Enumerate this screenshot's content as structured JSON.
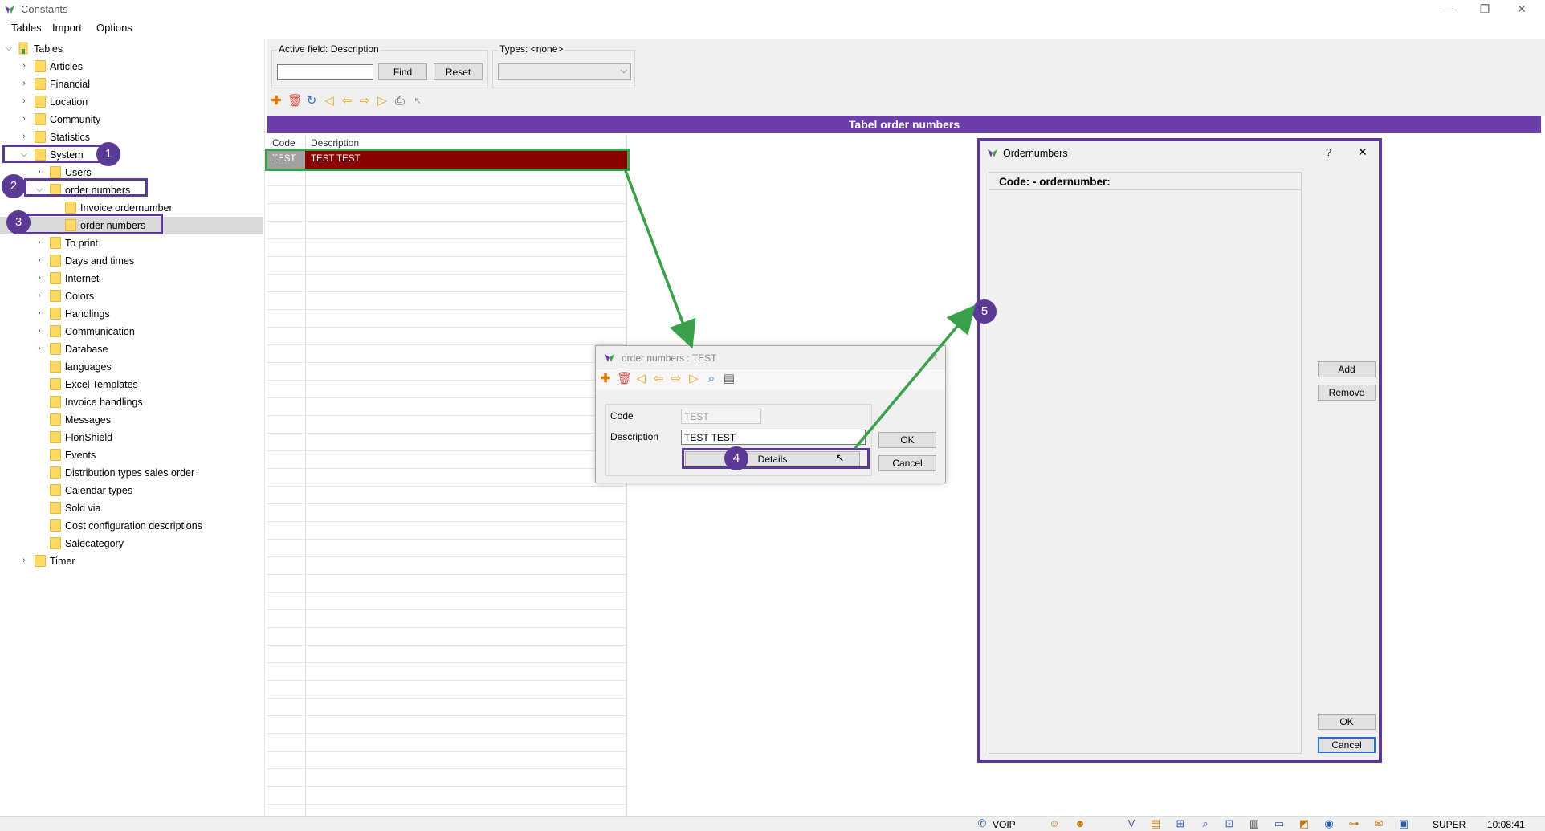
{
  "window": {
    "title": "Constants",
    "minimize": "—",
    "restore": "❐",
    "close": "✕"
  },
  "menu": [
    "Tables",
    "Import",
    "Options"
  ],
  "tree": {
    "root": "Tables",
    "nodes": [
      {
        "label": "Articles"
      },
      {
        "label": "Financial"
      },
      {
        "label": "Location"
      },
      {
        "label": "Community"
      },
      {
        "label": "Statistics"
      },
      {
        "label": "System"
      },
      {
        "label": "Users"
      },
      {
        "label": "order numbers"
      },
      {
        "label": "Invoice ordernumber"
      },
      {
        "label": "order numbers"
      },
      {
        "label": "To print"
      },
      {
        "label": "Days and times"
      },
      {
        "label": "Internet"
      },
      {
        "label": "Colors"
      },
      {
        "label": "Handlings"
      },
      {
        "label": "Communication"
      },
      {
        "label": "Database"
      },
      {
        "label": "languages"
      },
      {
        "label": "Excel Templates"
      },
      {
        "label": "Invoice handlings"
      },
      {
        "label": "Messages"
      },
      {
        "label": "FloriShield"
      },
      {
        "label": "Events"
      },
      {
        "label": "Distribution types sales order"
      },
      {
        "label": "Calendar types"
      },
      {
        "label": "Sold via"
      },
      {
        "label": "Cost configuration descriptions"
      },
      {
        "label": "Salecategory"
      },
      {
        "label": "Timer"
      }
    ]
  },
  "badges": [
    "1",
    "2",
    "3",
    "4",
    "5"
  ],
  "search": {
    "active_field_label": "Active field: Description",
    "find_label": "Find",
    "reset_label": "Reset",
    "types_label": "Types: <none>",
    "input_value": ""
  },
  "table": {
    "header": "Tabel order numbers",
    "columns": [
      "Code",
      "Description"
    ],
    "rows": [
      {
        "code": "TEST",
        "description": "TEST TEST"
      }
    ]
  },
  "dialog_record": {
    "title": "order numbers : TEST",
    "code_label": "Code",
    "code_value": "TEST",
    "description_label": "Description",
    "description_value": "TEST TEST",
    "details_label": "Details",
    "ok_label": "OK",
    "cancel_label": "Cancel"
  },
  "dialog_ordernumbers": {
    "title": "Ordernumbers",
    "help": "?",
    "close": "✕",
    "list_header": "Code:  - ordernumber:",
    "add_label": "Add",
    "remove_label": "Remove",
    "ok_label": "OK",
    "cancel_label": "Cancel"
  },
  "statusbar": {
    "voip": "VOIP",
    "user": "SUPER",
    "time": "10:08:41"
  },
  "colors": {
    "accent_purple": "#5b3a96",
    "header_purple": "#6c3fa8",
    "selected_row": "#8b0000",
    "annotation_green": "#3aa14a"
  }
}
